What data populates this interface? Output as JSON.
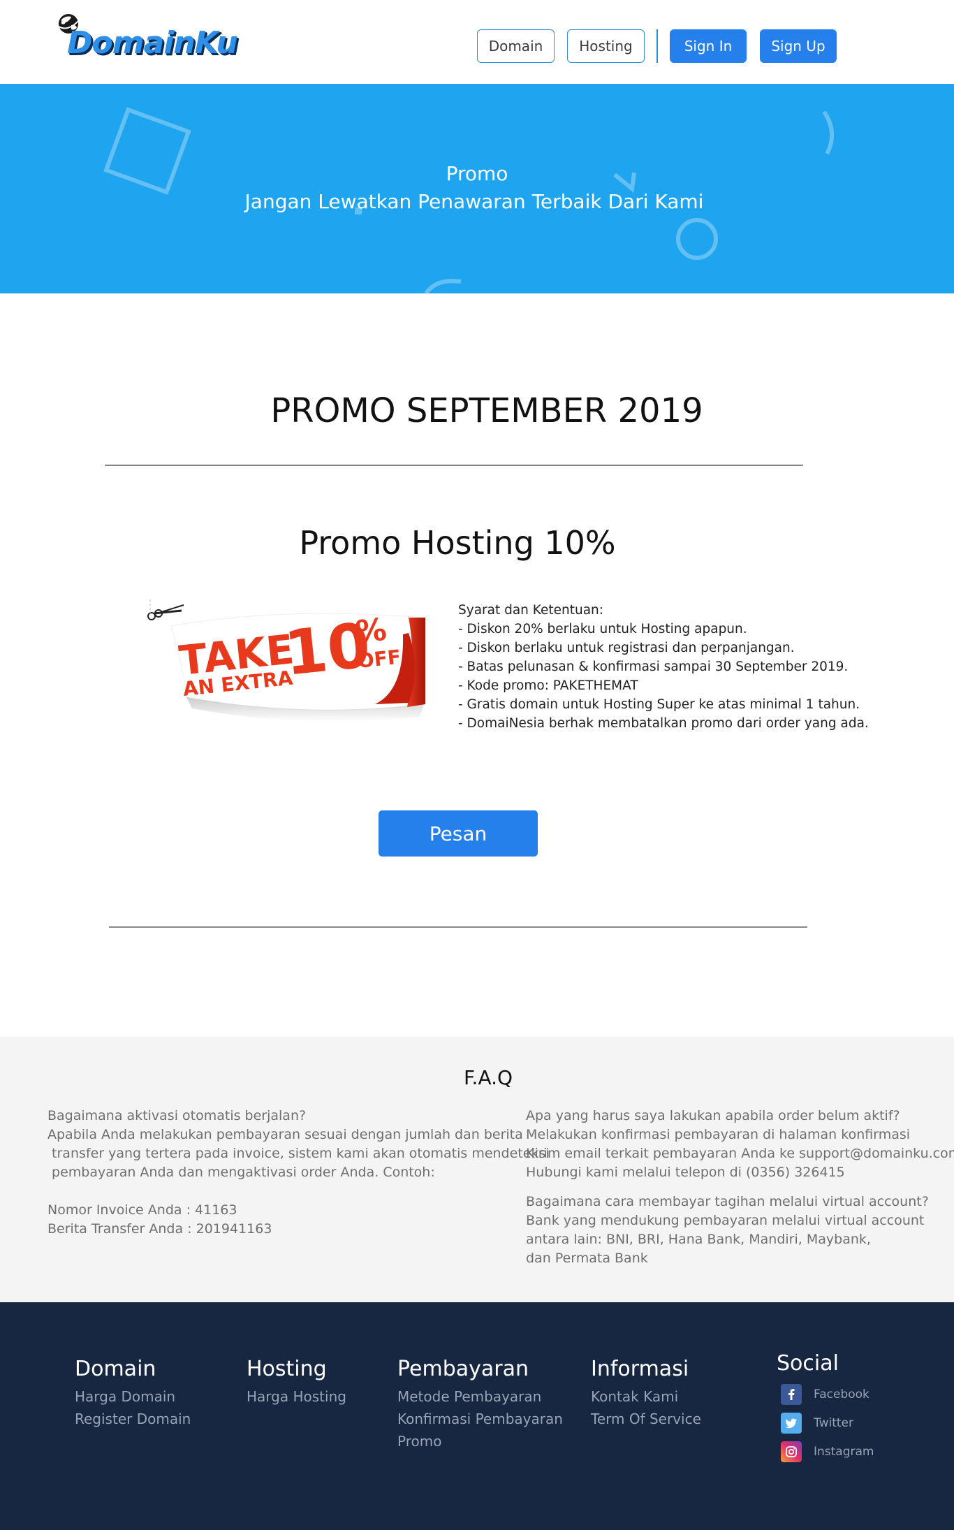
{
  "brand": {
    "logo_text": "DomainKu"
  },
  "nav": {
    "domain": "Domain",
    "hosting": "Hosting",
    "sign_in": "Sign In",
    "sign_up": "Sign Up"
  },
  "hero": {
    "title": "Promo",
    "subtitle": "Jangan Lewatkan Penawaran Terbaik Dari Kami"
  },
  "promo": {
    "heading": "PROMO SEPTEMBER 2019",
    "subheading": "Promo Hosting 10%",
    "coupon": {
      "take": "TAKE",
      "an_extra": "AN EXTRA",
      "percent": "10",
      "percent_sign": "%",
      "off": "OFF"
    },
    "terms": [
      "Syarat dan Ketentuan:",
      "- Diskon 20% berlaku untuk Hosting apapun.",
      "- Diskon berlaku untuk registrasi dan perpanjangan.",
      "- Batas pelunasan & konfirmasi sampai 30 September 2019.",
      "- Kode promo: PAKETHEMAT",
      "- Gratis domain untuk Hosting Super ke atas minimal 1 tahun.",
      "- DomaiNesia berhak membatalkan promo dari order yang ada."
    ],
    "order_button": "Pesan"
  },
  "faq": {
    "title": "F.A.Q",
    "left": {
      "q1": "Bagaimana aktivasi otomatis berjalan?",
      "a1": [
        "Apabila Anda melakukan pembayaran sesuai dengan jumlah dan berita",
        " transfer yang tertera pada invoice, sistem kami akan otomatis mendeteksi",
        " pembayaran Anda dan mengaktivasi order Anda. Contoh:"
      ],
      "example": [
        "Nomor Invoice Anda : 41163",
        "Berita Transfer Anda : 201941163"
      ]
    },
    "right": {
      "q1": "Apa yang harus saya lakukan apabila order belum aktif?",
      "a1": [
        "Melakukan konfirmasi pembayaran di halaman konfirmasi",
        "Kirim email terkait pembayaran Anda ke support@domainku.com",
        "Hubungi kami melalui telepon di (0356) 326415"
      ],
      "q2": "Bagaimana cara membayar tagihan melalui virtual account?",
      "a2": [
        "Bank yang mendukung pembayaran melalui virtual account",
        "antara lain: BNI, BRI, Hana Bank, Mandiri, Maybank,",
        "dan Permata Bank"
      ]
    }
  },
  "footer": {
    "domain": {
      "title": "Domain",
      "links": [
        "Harga Domain",
        "Register Domain"
      ]
    },
    "hosting": {
      "title": "Hosting",
      "links": [
        "Harga Hosting"
      ]
    },
    "pembayaran": {
      "title": "Pembayaran",
      "links": [
        "Metode Pembayaran",
        "Konfirmasi Pembayaran",
        "Promo"
      ]
    },
    "informasi": {
      "title": "Informasi",
      "links": [
        "Kontak Kami",
        "Term Of Service"
      ]
    },
    "social": {
      "title": "Social",
      "items": [
        {
          "label": "Facebook",
          "icon": "facebook-icon",
          "color": "#3b5998"
        },
        {
          "label": "Twitter",
          "icon": "twitter-icon",
          "color": "#55acee"
        },
        {
          "label": "Instagram",
          "icon": "instagram-icon",
          "color": "#e1306c"
        }
      ]
    }
  },
  "colors": {
    "primary": "#2680eb",
    "hero_bg": "#1fa5ef",
    "footer_bg": "#172641",
    "faq_bg": "#f4f4f4",
    "coupon_red": "#e8391d"
  }
}
